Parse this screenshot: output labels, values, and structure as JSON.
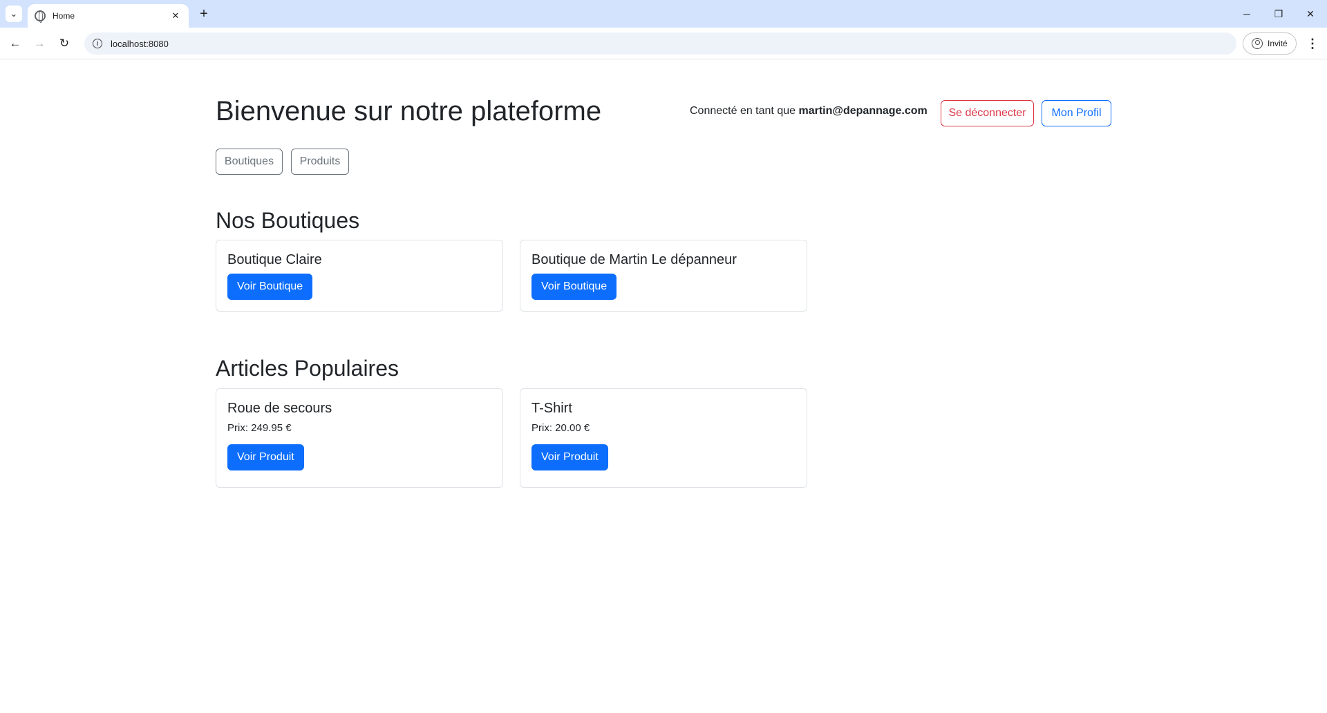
{
  "browser": {
    "tab_title": "Home",
    "url": "localhost:8080",
    "profile_label": "Invité",
    "icons": [
      "tab-search-icon",
      "globe-icon",
      "close-icon",
      "plus-icon",
      "minimize-icon",
      "restore-icon",
      "window-close-icon",
      "back-icon",
      "forward-icon",
      "reload-icon",
      "info-icon",
      "profile-icon",
      "kebab-menu-icon"
    ]
  },
  "header": {
    "title": "Bienvenue sur notre plateforme",
    "connected_prefix": "Connecté en tant que",
    "user_email": "martin@depannage.com",
    "logout_label": "Se déconnecter",
    "profile_label": "Mon Profil"
  },
  "nav": {
    "boutiques_label": "Boutiques",
    "produits_label": "Produits"
  },
  "shops": {
    "title": "Nos Boutiques",
    "items": [
      {
        "name": "Boutique Claire",
        "button": "Voir Boutique"
      },
      {
        "name": "Boutique de Martin Le dépanneur",
        "button": "Voir Boutique"
      }
    ]
  },
  "articles": {
    "title": "Articles Populaires",
    "items": [
      {
        "name": "Roue de secours",
        "price": "Prix: 249.95 €",
        "button": "Voir Produit"
      },
      {
        "name": "T-Shirt",
        "price": "Prix: 20.00 €",
        "button": "Voir Produit"
      }
    ]
  },
  "colors": {
    "primary": "#0d6efd",
    "danger": "#dc3545",
    "secondary": "#6c757d",
    "tabstrip": "#d3e3fd"
  }
}
